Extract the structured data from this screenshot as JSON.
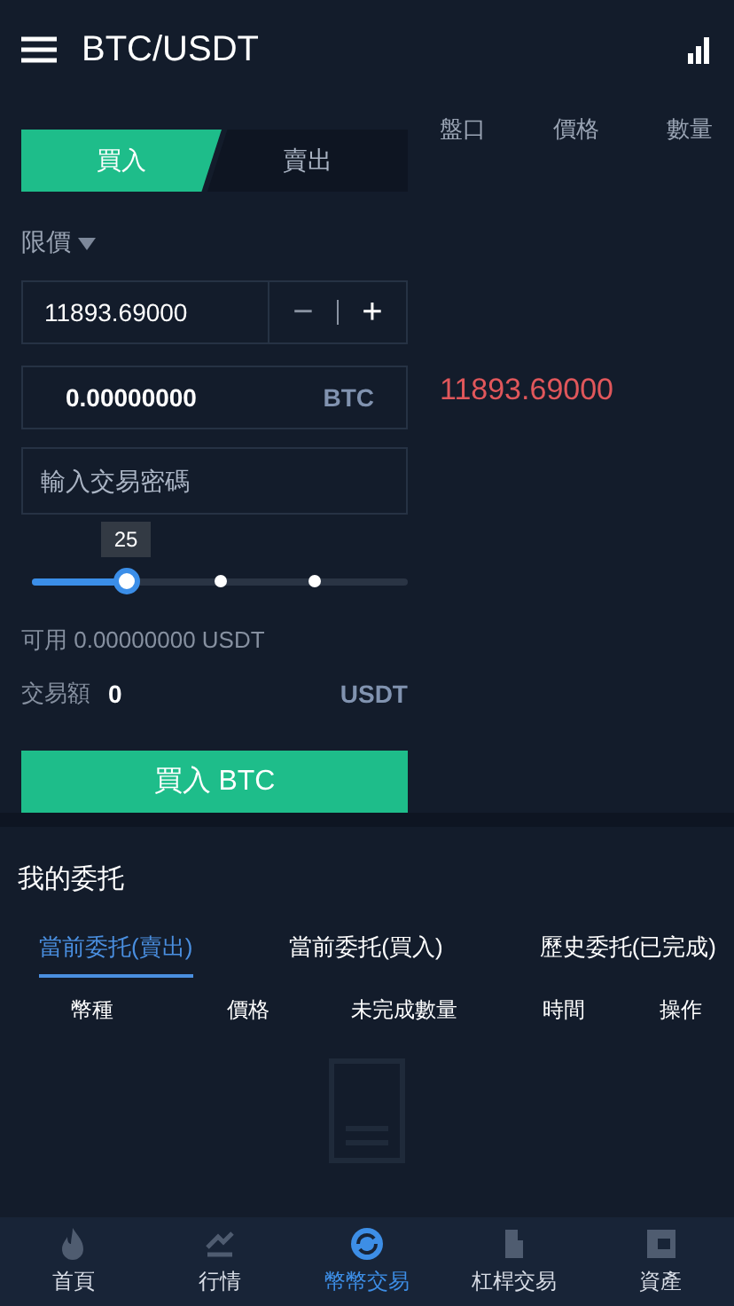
{
  "header": {
    "title": "BTC/USDT"
  },
  "trade_tabs": [
    {
      "label": "買入",
      "selected": true
    },
    {
      "label": "賣出",
      "selected": false
    }
  ],
  "order_type": "限價",
  "price_field": {
    "value": "11893.69000",
    "minus": "−",
    "plus": "+"
  },
  "amount_field": {
    "value": "0.00000000",
    "unit": "BTC"
  },
  "password_field": {
    "placeholder": "輸入交易密碼"
  },
  "slider": {
    "level": 0.25,
    "tooltip": "25"
  },
  "available": "可用 0.00000000 USDT",
  "turnover": {
    "label": "交易額",
    "value": "0",
    "unit": "USDT"
  },
  "submit": "買入 BTC",
  "book": {
    "columns": [
      "盤口",
      "價格",
      "數量"
    ],
    "last_price": "11893.69000"
  },
  "orders": {
    "title": "我的委托",
    "tabs": [
      {
        "label": "當前委托(賣出)",
        "selected": true
      },
      {
        "label": "當前委托(買入)",
        "selected": false
      },
      {
        "label": "歷史委托(已完成)",
        "selected": false
      }
    ],
    "columns": [
      "幣種",
      "價格",
      "未完成數量",
      "時間",
      "操作"
    ]
  },
  "nav": [
    {
      "label": "首頁",
      "selected": false,
      "kind": "flame"
    },
    {
      "label": "行情",
      "selected": false,
      "kind": "chart"
    },
    {
      "label": "幣幣交易",
      "selected": true,
      "kind": "exchange"
    },
    {
      "label": "杠桿交易",
      "selected": false,
      "kind": "lever"
    },
    {
      "label": "資產",
      "selected": false,
      "kind": "wallet"
    }
  ]
}
